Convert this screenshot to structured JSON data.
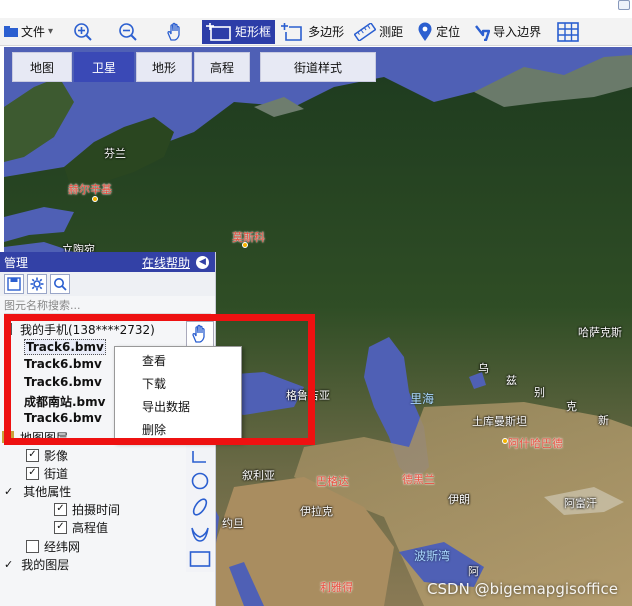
{
  "toolbar": {
    "items": [
      {
        "label": "文件",
        "icon": "file-icon",
        "has_dropdown": true
      },
      {
        "label": "",
        "icon": "zoom-in-icon"
      },
      {
        "label": "",
        "icon": "zoom-out-icon"
      },
      {
        "label": "",
        "icon": "pan-hand-icon"
      },
      {
        "label": "矩形框",
        "icon": "rectangle-select-icon",
        "active": true
      },
      {
        "label": "多边形",
        "icon": "polygon-select-icon"
      },
      {
        "label": "测距",
        "icon": "ruler-icon"
      },
      {
        "label": "定位",
        "icon": "location-pin-icon"
      },
      {
        "label": "导入边界",
        "icon": "import-boundary-icon"
      },
      {
        "label": "",
        "icon": "grid-icon"
      }
    ],
    "dropdown_arrow": "▾"
  },
  "map_tabs": [
    {
      "label": "地图",
      "active": false
    },
    {
      "label": "卫星",
      "active": true
    },
    {
      "label": "地形",
      "active": false
    },
    {
      "label": "高程",
      "active": false
    },
    {
      "label": "街道样式",
      "active": false
    }
  ],
  "place_labels": {
    "finland": "芬兰",
    "helsinki": "赫尔辛基",
    "lithuania": "立陶宛",
    "moscow": "莫斯科",
    "kazakhstan": "哈萨克斯",
    "uzbekistan": "乌",
    "uzbekistan2": "兹",
    "georgia": "格鲁吉亚",
    "caspian": "里海",
    "kyrgyz": "别",
    "kyrgyz2": "克",
    "xinjiang": "新",
    "turkmenistan": "土库曼斯坦",
    "ashgabat": "阿什哈巴德",
    "syria": "叙利亚",
    "baghdad": "巴格达",
    "tehran": "德黑兰",
    "iran": "伊朗",
    "afghanistan": "阿富汗",
    "iraq": "伊拉克",
    "jordan": "约旦",
    "gulf": "波斯湾",
    "oman": "阿",
    "riyadh": "利雅得"
  },
  "panel": {
    "title": "管理",
    "help_link": "在线帮助",
    "collapse_glyph": "◀",
    "search_placeholder": "图元名称搜索...",
    "my_phone": "我的手机(138****2732)",
    "tracks": [
      "Track6.bmv",
      "Track6.bmv",
      "Track6.bmv",
      "成都南站.bmv",
      "Track6.bmv"
    ],
    "map_layers": "地图图层",
    "imagery": "影像",
    "streets": "街道",
    "other_props": "其他属性",
    "shoot_time": "拍摄时间",
    "elevation": "高程值",
    "graticule": "经纬网",
    "my_layers": "我的图层",
    "check_glyph": "✓"
  },
  "context_menu": {
    "items": [
      "查看",
      "下载",
      "导出数据",
      "删除"
    ]
  },
  "watermark": "CSDN @bigemapgisoffice",
  "colors": {
    "toolbar_active": "#2c3da8",
    "panel_header": "#3341a6",
    "highlight": "#ee1111",
    "water": "#4f60b5"
  }
}
